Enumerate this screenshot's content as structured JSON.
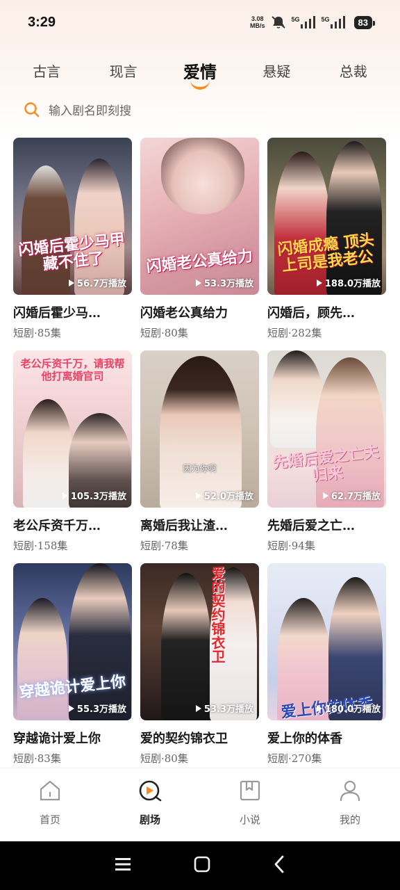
{
  "status": {
    "time": "3:29",
    "net_speed_value": "3.08",
    "net_speed_unit": "MB/s",
    "sim1": "5G",
    "sim2": "5G",
    "battery": "83"
  },
  "categories": [
    {
      "label": "古言",
      "active": false
    },
    {
      "label": "现言",
      "active": false
    },
    {
      "label": "爱情",
      "active": true
    },
    {
      "label": "悬疑",
      "active": false
    },
    {
      "label": "总裁",
      "active": false
    }
  ],
  "search": {
    "placeholder": "输入剧名即刻搜"
  },
  "dramas": [
    {
      "title": "闪婚后霍少马…",
      "meta": "短剧·85集",
      "plays": "56.7万播放",
      "poster_text": "闪婚后霍少马甲藏不住了"
    },
    {
      "title": "闪婚老公真给力",
      "meta": "短剧·80集",
      "plays": "53.3万播放",
      "poster_text": "闪婚老公真给力"
    },
    {
      "title": "闪婚后，顾先…",
      "meta": "短剧·282集",
      "plays": "188.0万播放",
      "poster_text": "闪婚成瘾 顶头上司是我老公"
    },
    {
      "title": "老公斥资千万…",
      "meta": "短剧·158集",
      "plays": "105.3万播放",
      "poster_text": "老公斥资千万，请我帮他打离婚官司"
    },
    {
      "title": "离婚后我让渣…",
      "meta": "短剧·78集",
      "plays": "52.0万播放",
      "poster_text": "因为你啊"
    },
    {
      "title": "先婚后爱之亡…",
      "meta": "短剧·94集",
      "plays": "62.7万播放",
      "poster_text": "先婚后爱之亡夫归来"
    },
    {
      "title": "穿越诡计爱上你",
      "meta": "短剧·83集",
      "plays": "55.3万播放",
      "poster_text": "穿越诡计爱上你"
    },
    {
      "title": "爱的契约锦衣卫",
      "meta": "短剧·80集",
      "plays": "53.3万播放",
      "poster_text": "爱的契约锦衣卫"
    },
    {
      "title": "爱上你的体香",
      "meta": "短剧·270集",
      "plays": "180.0万播放",
      "poster_text": "爱上你的体香"
    }
  ],
  "nav": [
    {
      "label": "首页",
      "icon": "home-icon",
      "active": false
    },
    {
      "label": "剧场",
      "icon": "theater-play-icon",
      "active": true
    },
    {
      "label": "小说",
      "icon": "book-icon",
      "active": false
    },
    {
      "label": "我的",
      "icon": "profile-icon",
      "active": false
    }
  ],
  "colors": {
    "accent": "#ff8a1f"
  }
}
